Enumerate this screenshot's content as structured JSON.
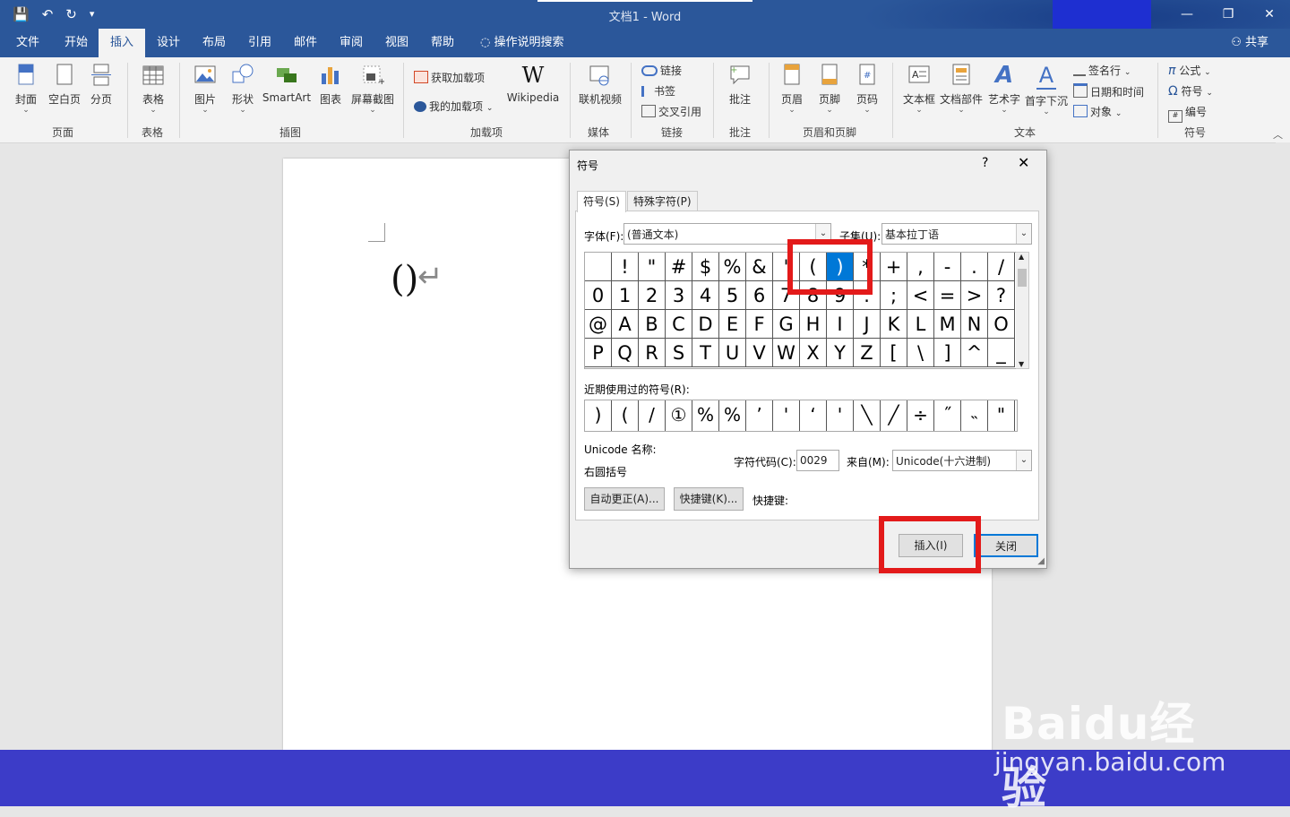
{
  "window": {
    "title": "文档1  -  Word",
    "minimize": "—",
    "restore": "❐",
    "close": "✕"
  },
  "qat": {
    "save_icon": "💾",
    "undo_icon": "↶",
    "redo_icon": "↻",
    "customize_icon": "▾"
  },
  "menu": {
    "tabs": [
      "文件",
      "开始",
      "插入",
      "设计",
      "布局",
      "引用",
      "邮件",
      "审阅",
      "视图",
      "帮助"
    ],
    "active_index": 2,
    "tell_me": "操作说明搜索",
    "share": "共享"
  },
  "ribbon": {
    "pages": {
      "cover": "封面",
      "blank": "空白页",
      "break": "分页",
      "group": "页面"
    },
    "tables": {
      "table": "表格",
      "group": "表格"
    },
    "illustrations": {
      "pictures": "图片",
      "shapes": "形状",
      "smartart": "SmartArt",
      "chart": "图表",
      "screenshot": "屏幕截图",
      "group": "插图"
    },
    "addins": {
      "get": "获取加载项",
      "my": "我的加载项",
      "wikipedia": "Wikipedia",
      "group": "加载项"
    },
    "media": {
      "video": "联机视频",
      "group": "媒体"
    },
    "links": {
      "link": "链接",
      "bookmark": "书签",
      "cross_ref": "交叉引用",
      "group": "链接"
    },
    "comments": {
      "comment": "批注",
      "group": "批注"
    },
    "header_footer": {
      "header": "页眉",
      "footer": "页脚",
      "page_number": "页码",
      "group": "页眉和页脚"
    },
    "text": {
      "textbox": "文本框",
      "quick_parts": "文档部件",
      "wordart": "艺术字",
      "dropcap": "首字下沉",
      "signature": "签名行",
      "datetime": "日期和时间",
      "object": "对象",
      "group": "文本"
    },
    "symbols": {
      "equation": "公式",
      "symbol": "符号",
      "number": "编号",
      "group": "符号"
    }
  },
  "document": {
    "text": "()",
    "paragraph_mark": "↵"
  },
  "dialog": {
    "title": "符号",
    "help": "?",
    "close": "✕",
    "tabs": [
      "符号(S)",
      "特殊字符(P)"
    ],
    "font_label": "字体(F):",
    "font_value": "(普通文本)",
    "subset_label": "子集(U):",
    "subset_value": "基本拉丁语",
    "grid": [
      [
        " ",
        "!",
        "\"",
        "#",
        "$",
        "%",
        "&",
        "'",
        "(",
        ")",
        "*",
        "+",
        ",",
        "-",
        ".",
        "/"
      ],
      [
        "0",
        "1",
        "2",
        "3",
        "4",
        "5",
        "6",
        "7",
        "8",
        "9",
        ":",
        ";",
        "<",
        "=",
        ">",
        "?"
      ],
      [
        "@",
        "A",
        "B",
        "C",
        "D",
        "E",
        "F",
        "G",
        "H",
        "I",
        "J",
        "K",
        "L",
        "M",
        "N",
        "O"
      ],
      [
        "P",
        "Q",
        "R",
        "S",
        "T",
        "U",
        "V",
        "W",
        "X",
        "Y",
        "Z",
        "[",
        "\\",
        "]",
        "^",
        "_"
      ]
    ],
    "selected_cell": [
      0,
      9
    ],
    "recent_label": "近期使用过的符号(R):",
    "recent": [
      ")",
      "(",
      "/",
      "①",
      "%",
      "%",
      "’",
      "'",
      "‘",
      "'",
      "╲",
      "╱",
      "÷",
      "˝",
      "˵",
      "\""
    ],
    "unicode_name_label": "Unicode 名称:",
    "unicode_name_value": "右圆括号",
    "char_code_label": "字符代码(C):",
    "char_code_value": "0029",
    "from_label": "来自(M):",
    "from_value": "Unicode(十六进制)",
    "autocorrect_btn": "自动更正(A)...",
    "shortcut_btn": "快捷键(K)...",
    "shortcut_label": "快捷键:",
    "insert_btn": "插入(I)",
    "close_btn": "关闭"
  },
  "highlight_color": "#e31a1a",
  "watermark": {
    "logo": "Baidu经验",
    "url": "jingyan.baidu.com"
  }
}
